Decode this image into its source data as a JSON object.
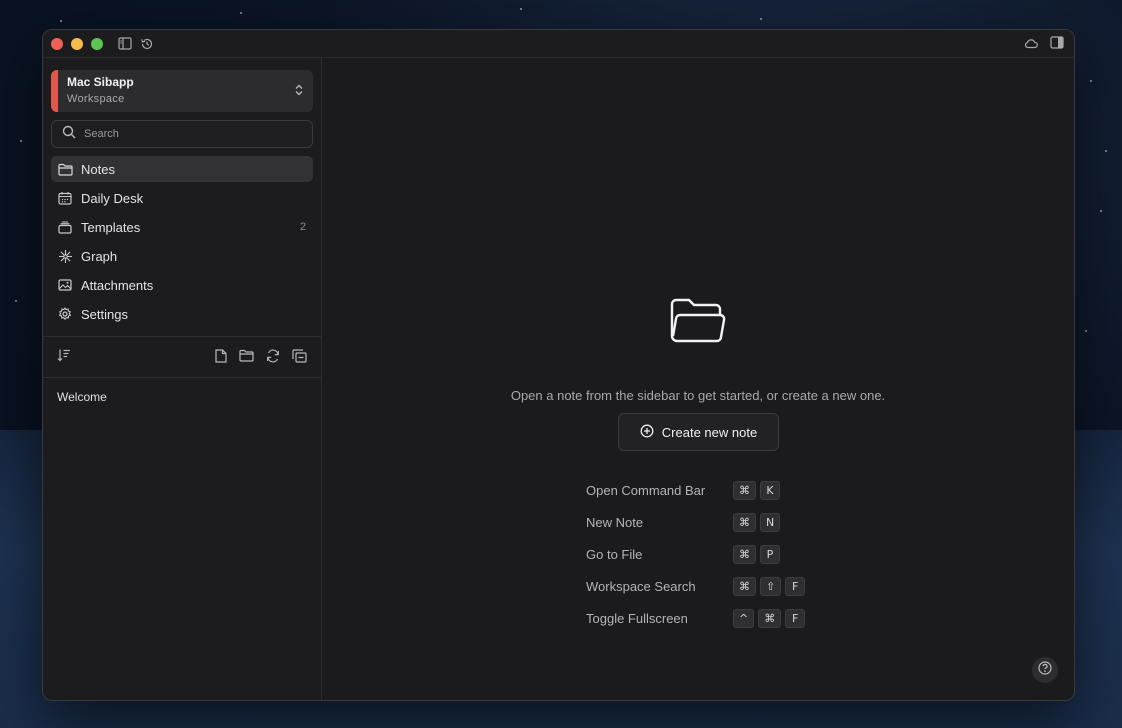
{
  "workspace": {
    "name": "Mac Sibapp",
    "subtitle": "Workspace"
  },
  "search": {
    "placeholder": "Search"
  },
  "nav": [
    {
      "label": "Notes",
      "icon": "folder-icon",
      "active": true
    },
    {
      "label": "Daily Desk",
      "icon": "calendar-icon"
    },
    {
      "label": "Templates",
      "icon": "template-icon",
      "count": "2"
    },
    {
      "label": "Graph",
      "icon": "graph-icon"
    },
    {
      "label": "Attachments",
      "icon": "image-icon"
    },
    {
      "label": "Settings",
      "icon": "gear-icon"
    }
  ],
  "files": [
    {
      "name": "Welcome"
    }
  ],
  "main": {
    "empty_message": "Open a note from the sidebar to get started, or create a new one.",
    "create_button": "Create new note",
    "shortcuts": [
      {
        "label": "Open Command Bar",
        "keys": [
          "⌘",
          "K"
        ]
      },
      {
        "label": "New Note",
        "keys": [
          "⌘",
          "N"
        ]
      },
      {
        "label": "Go to File",
        "keys": [
          "⌘",
          "P"
        ]
      },
      {
        "label": "Workspace Search",
        "keys": [
          "⌘",
          "⇧",
          "F"
        ]
      },
      {
        "label": "Toggle Fullscreen",
        "keys": [
          "^",
          "⌘",
          "F"
        ]
      }
    ]
  },
  "colors": {
    "accent": "#e2574c",
    "window_bg": "#1a1a1c",
    "sidebar_bg": "#1c1c1e"
  }
}
